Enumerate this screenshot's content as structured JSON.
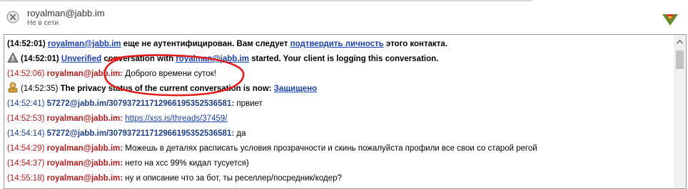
{
  "header": {
    "contact_name": "royalman@jabb.im",
    "contact_status": "Не в сети"
  },
  "messages": [
    {
      "time": "(14:52:01)",
      "sender": "royalman@jabb.im",
      "text1": " еще не аутентифицирован. Вам следует ",
      "link": "подтвердить личность",
      "text2": " этого контакта."
    },
    {
      "time": "(14:52:01)",
      "link1": "Unverified",
      "text1": " conversation with ",
      "link2": "royalman@jabb.im",
      "text2": " started.  Your client is logging this conversation."
    },
    {
      "time": "(14:52:06)",
      "sender": "royalman@jabb.im:",
      "text": " Доброго времени суток!"
    },
    {
      "time": "(14:52:35)",
      "text": "The privacy status of the current conversation is now: ",
      "link": "Защищено"
    },
    {
      "time": "(14:52:41)",
      "sender": "57272@jabb.im/30793721171296619535253658​1:",
      "text": " првиет"
    },
    {
      "time": "(14:52:53)",
      "sender": "royalman@jabb.im:",
      "link": "https://xss.is/threads/37459/"
    },
    {
      "time": "(14:54:14)",
      "sender": "57272@jabb.im/30793721171296619535253658​1:",
      "text": " да"
    },
    {
      "time": "(14:54:29)",
      "sender": "royalman@jabb.im:",
      "text": " Можешь в деталях расписать условия прозрачности и скинь пожалуйста профили все свои со старой регой"
    },
    {
      "time": "(14:54:37)",
      "sender": "royalman@jabb.im:",
      "text": " нето на хсс 99% кидал тусуется)"
    },
    {
      "time": "(14:55:18)",
      "sender": "royalman@jabb.im:",
      "text": " ну и описание что за бот, ты реселлер/посредник/кодер?"
    }
  ],
  "colors": {
    "own_message": "#b31b1b",
    "peer_message": "#1d3f8a",
    "link": "#0000ee",
    "annotation_circle": "#e31d1d"
  },
  "icons": {
    "status": "offline-x-icon",
    "app_logo": "pidgin-logo-icon",
    "warning": "warning-triangle-icon",
    "privacy": "privacy-lock-icon"
  }
}
